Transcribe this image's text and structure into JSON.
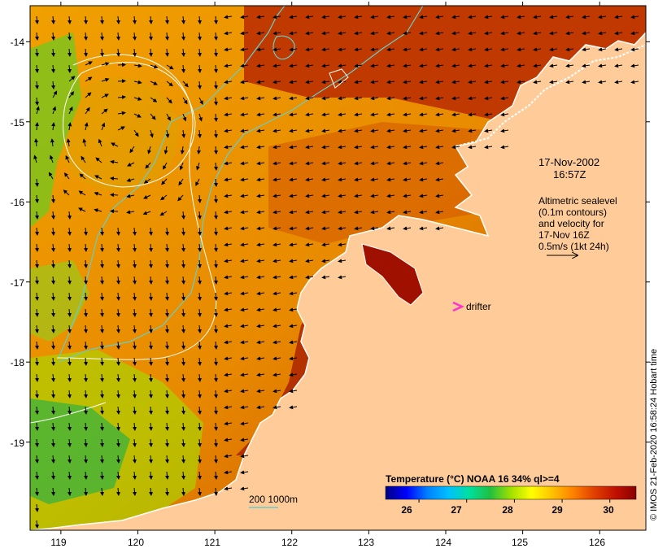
{
  "map": {
    "lon_range": [
      118.6,
      126.6
    ],
    "lat_range": [
      -20.1,
      -13.55
    ],
    "lon_ticks": [
      "119",
      "120",
      "121",
      "122",
      "123",
      "124",
      "125",
      "126"
    ],
    "lat_ticks": [
      "-14",
      "-15",
      "-16",
      "-17",
      "-18",
      "-19"
    ],
    "land_color": "#ffcc99",
    "coast_color": "#ffffff",
    "contour_color": "#66cccc",
    "sealevel_contour_color": "#ffffff",
    "drifter_color": "#ff33cc"
  },
  "annotations": {
    "date_line1": "17-Nov-2002",
    "date_line2": "16:57Z",
    "info_line1": "Altimetric sealevel",
    "info_line2": "(0.1m contours)",
    "info_line3": "and velocity for",
    "info_line4": "17-Nov 16Z",
    "info_line5": "0.5m/s (1kt 24h)",
    "drifter_label": "drifter",
    "bathy_label": "200  1000m"
  },
  "colorbar": {
    "title": "Temperature (°C) NOAA 16 34% ql>=4",
    "ticks": [
      "26",
      "27",
      "28",
      "29",
      "30"
    ],
    "tick_values": [
      26,
      27,
      28,
      29,
      30
    ],
    "range": [
      25.3,
      30.55
    ],
    "colors": [
      "#000080",
      "#0000ff",
      "#0080ff",
      "#00c0ff",
      "#00e0a0",
      "#20c040",
      "#a0e000",
      "#ffff00",
      "#ffc000",
      "#ff8000",
      "#e04000",
      "#c01000",
      "#8b0000"
    ]
  },
  "credit": "© IMOS 21-Feb-2020 16:58:24 Hobart time"
}
